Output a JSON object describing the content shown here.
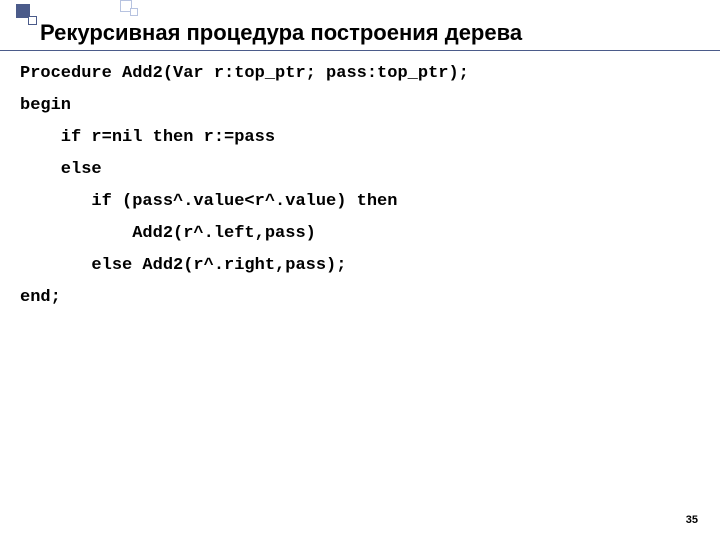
{
  "title": "Рекурсивная процедура построения дерева",
  "code": {
    "l1": "Procedure Add2(Var r:top_ptr; pass:top_ptr);",
    "l2": "begin",
    "l3": "    if r=nil then r:=pass",
    "l4": "    else",
    "l5": "       if (pass^.value<r^.value) then",
    "l6": "           Add2(r^.left,pass)",
    "l7": "       else Add2(r^.right,pass);",
    "l8": "end;"
  },
  "page_number": "35"
}
